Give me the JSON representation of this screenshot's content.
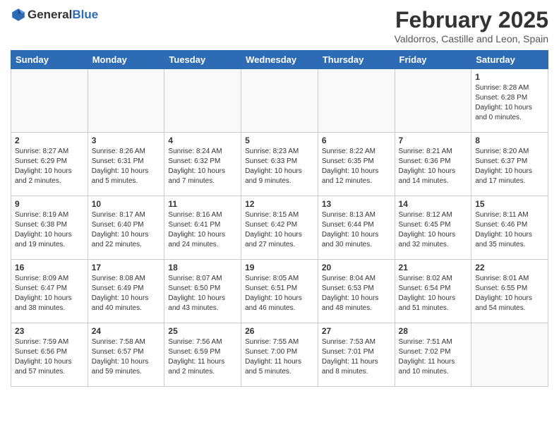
{
  "header": {
    "logo_general": "General",
    "logo_blue": "Blue",
    "month_title": "February 2025",
    "subtitle": "Valdorros, Castille and Leon, Spain"
  },
  "days_of_week": [
    "Sunday",
    "Monday",
    "Tuesday",
    "Wednesday",
    "Thursday",
    "Friday",
    "Saturday"
  ],
  "weeks": [
    [
      {
        "day": "",
        "info": ""
      },
      {
        "day": "",
        "info": ""
      },
      {
        "day": "",
        "info": ""
      },
      {
        "day": "",
        "info": ""
      },
      {
        "day": "",
        "info": ""
      },
      {
        "day": "",
        "info": ""
      },
      {
        "day": "1",
        "info": "Sunrise: 8:28 AM\nSunset: 6:28 PM\nDaylight: 10 hours and 0 minutes."
      }
    ],
    [
      {
        "day": "2",
        "info": "Sunrise: 8:27 AM\nSunset: 6:29 PM\nDaylight: 10 hours and 2 minutes."
      },
      {
        "day": "3",
        "info": "Sunrise: 8:26 AM\nSunset: 6:31 PM\nDaylight: 10 hours and 5 minutes."
      },
      {
        "day": "4",
        "info": "Sunrise: 8:24 AM\nSunset: 6:32 PM\nDaylight: 10 hours and 7 minutes."
      },
      {
        "day": "5",
        "info": "Sunrise: 8:23 AM\nSunset: 6:33 PM\nDaylight: 10 hours and 9 minutes."
      },
      {
        "day": "6",
        "info": "Sunrise: 8:22 AM\nSunset: 6:35 PM\nDaylight: 10 hours and 12 minutes."
      },
      {
        "day": "7",
        "info": "Sunrise: 8:21 AM\nSunset: 6:36 PM\nDaylight: 10 hours and 14 minutes."
      },
      {
        "day": "8",
        "info": "Sunrise: 8:20 AM\nSunset: 6:37 PM\nDaylight: 10 hours and 17 minutes."
      }
    ],
    [
      {
        "day": "9",
        "info": "Sunrise: 8:19 AM\nSunset: 6:38 PM\nDaylight: 10 hours and 19 minutes."
      },
      {
        "day": "10",
        "info": "Sunrise: 8:17 AM\nSunset: 6:40 PM\nDaylight: 10 hours and 22 minutes."
      },
      {
        "day": "11",
        "info": "Sunrise: 8:16 AM\nSunset: 6:41 PM\nDaylight: 10 hours and 24 minutes."
      },
      {
        "day": "12",
        "info": "Sunrise: 8:15 AM\nSunset: 6:42 PM\nDaylight: 10 hours and 27 minutes."
      },
      {
        "day": "13",
        "info": "Sunrise: 8:13 AM\nSunset: 6:44 PM\nDaylight: 10 hours and 30 minutes."
      },
      {
        "day": "14",
        "info": "Sunrise: 8:12 AM\nSunset: 6:45 PM\nDaylight: 10 hours and 32 minutes."
      },
      {
        "day": "15",
        "info": "Sunrise: 8:11 AM\nSunset: 6:46 PM\nDaylight: 10 hours and 35 minutes."
      }
    ],
    [
      {
        "day": "16",
        "info": "Sunrise: 8:09 AM\nSunset: 6:47 PM\nDaylight: 10 hours and 38 minutes."
      },
      {
        "day": "17",
        "info": "Sunrise: 8:08 AM\nSunset: 6:49 PM\nDaylight: 10 hours and 40 minutes."
      },
      {
        "day": "18",
        "info": "Sunrise: 8:07 AM\nSunset: 6:50 PM\nDaylight: 10 hours and 43 minutes."
      },
      {
        "day": "19",
        "info": "Sunrise: 8:05 AM\nSunset: 6:51 PM\nDaylight: 10 hours and 46 minutes."
      },
      {
        "day": "20",
        "info": "Sunrise: 8:04 AM\nSunset: 6:53 PM\nDaylight: 10 hours and 48 minutes."
      },
      {
        "day": "21",
        "info": "Sunrise: 8:02 AM\nSunset: 6:54 PM\nDaylight: 10 hours and 51 minutes."
      },
      {
        "day": "22",
        "info": "Sunrise: 8:01 AM\nSunset: 6:55 PM\nDaylight: 10 hours and 54 minutes."
      }
    ],
    [
      {
        "day": "23",
        "info": "Sunrise: 7:59 AM\nSunset: 6:56 PM\nDaylight: 10 hours and 57 minutes."
      },
      {
        "day": "24",
        "info": "Sunrise: 7:58 AM\nSunset: 6:57 PM\nDaylight: 10 hours and 59 minutes."
      },
      {
        "day": "25",
        "info": "Sunrise: 7:56 AM\nSunset: 6:59 PM\nDaylight: 11 hours and 2 minutes."
      },
      {
        "day": "26",
        "info": "Sunrise: 7:55 AM\nSunset: 7:00 PM\nDaylight: 11 hours and 5 minutes."
      },
      {
        "day": "27",
        "info": "Sunrise: 7:53 AM\nSunset: 7:01 PM\nDaylight: 11 hours and 8 minutes."
      },
      {
        "day": "28",
        "info": "Sunrise: 7:51 AM\nSunset: 7:02 PM\nDaylight: 11 hours and 10 minutes."
      },
      {
        "day": "",
        "info": ""
      }
    ]
  ]
}
